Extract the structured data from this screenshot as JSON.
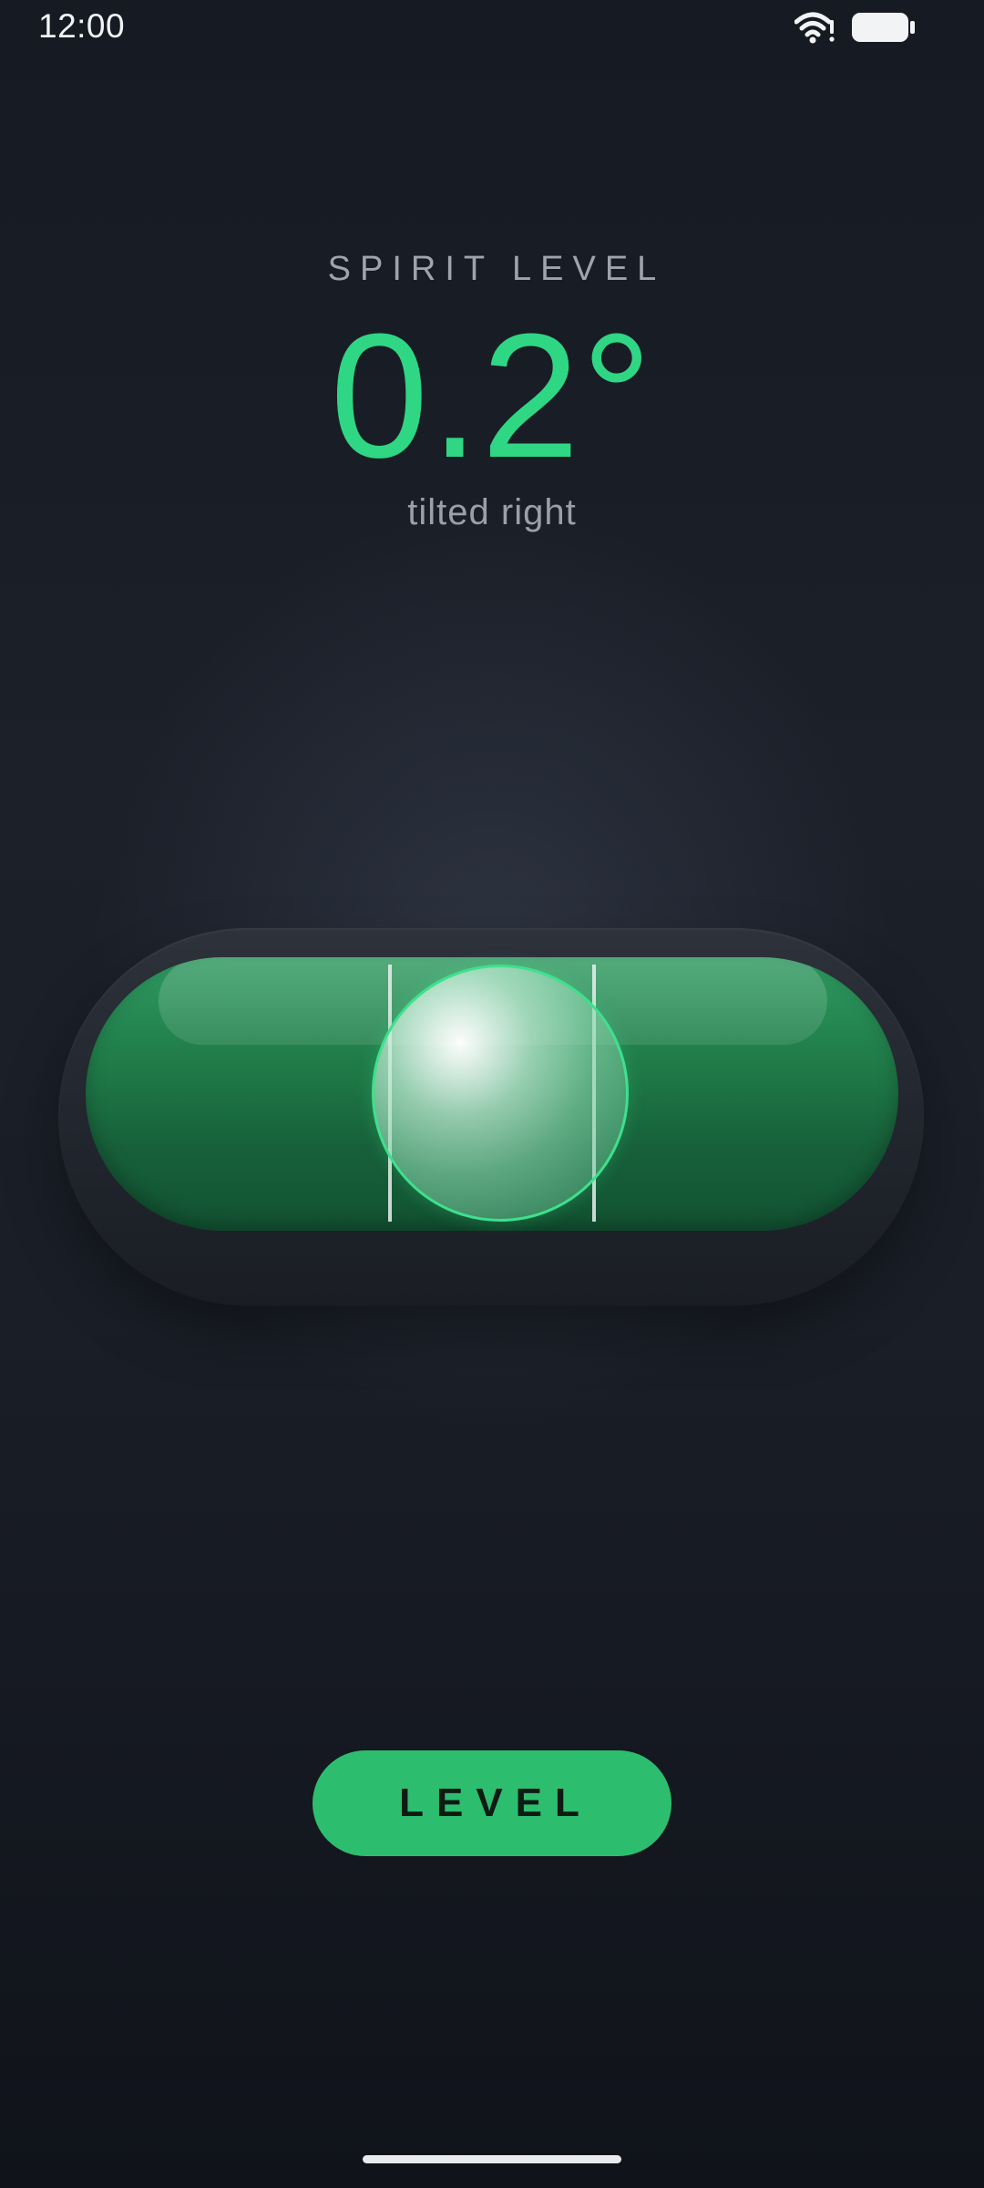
{
  "status_bar": {
    "time": "12:00",
    "wifi_icon": "wifi-alert-icon",
    "battery_icon": "battery-full-icon"
  },
  "header": {
    "app_label": "SPIRIT LEVEL",
    "angle": "0.2°",
    "direction": "tilted right"
  },
  "vial": {
    "bubble_offset_deg": 0.2,
    "tube_color": "#1f7a48",
    "bubble_ring_color": "#3ee08d"
  },
  "controls": {
    "level_button_label": "LEVEL"
  },
  "colors": {
    "accent": "#2fd684",
    "button": "#2dbd6e",
    "background": "#1a1e27"
  }
}
